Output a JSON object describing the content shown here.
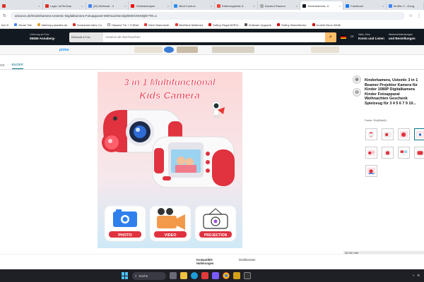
{
  "browser": {
    "tabs": [
      {
        "label": "",
        "color": "#d93025"
      },
      {
        "label": "Login: raTfe14an",
        "color": "#d93025"
      },
      {
        "label": "(20) Webmail - 4",
        "color": "#4285f4"
      },
      {
        "label": "Ghettoklampne",
        "color": "#ff0000"
      },
      {
        "label": "Mind Control -",
        "color": "#2b8ef0"
      },
      {
        "label": "Erfahrungsfeld: A",
        "color": "#f54336"
      },
      {
        "label": "Kamera Raumur",
        "color": "#aaaaaa"
      },
      {
        "label": "Kinderkamera, U",
        "color": "#131921",
        "active": true
      },
      {
        "label": "Facebook",
        "color": "#1877f2"
      },
      {
        "label": "fertiflor 2 - Goog",
        "color": "#4285f4"
      }
    ],
    "url": "amazon.de/Kinderkamera-Usteetic-Digitalkamera-Fotoapparat-Weihnachten/dp/B0DXXKMQB7?th=1",
    "bookmarks": [
      {
        "label": "hen K",
        "color": "#888"
      },
      {
        "label": "Neuer Tab",
        "color": "#4285f4"
      },
      {
        "label": "tabletop-paradies.de",
        "color": "#e0a030"
      },
      {
        "label": "Download video Co",
        "color": "#d93025"
      },
      {
        "label": "Hawese Tür + FuRart",
        "color": "#ffffff"
      },
      {
        "label": "Mein Warenkorb",
        "color": "#e53935"
      },
      {
        "label": "BestNetz Multimed",
        "color": "#e53935"
      },
      {
        "label": "SoBuy Regal BZR11",
        "color": "#c00"
      },
      {
        "label": "Software Upgrade",
        "color": "#555"
      },
      {
        "label": "SoBuy Waschbecke",
        "color": "#c00"
      },
      {
        "label": "Dunkle Neue Weltb",
        "color": "#c00"
      }
    ]
  },
  "amazon": {
    "deliver_line1": "Lieferung an Dino",
    "deliver_line2": "08456 Annaberg-",
    "search_category": "Elektronik & Foto",
    "search_placeholder": "Amazon.de durchsuchen",
    "account_line1": "Hallo, Dino",
    "account_line2": "Konto und Listen",
    "returns_line1": "Warenrücksendungen",
    "returns_line2": "und Bestellungen",
    "lang": "DE",
    "prime": "prime"
  },
  "subnav": {
    "tabs": [
      "OS",
      "BILDER"
    ],
    "active": 1
  },
  "product_image": {
    "headline1": "3 in 1 Multifunctional",
    "headline2": "Kids Camera",
    "labels": [
      "PHOTO",
      "VIDEO",
      "PROJECTION"
    ]
  },
  "product": {
    "title": "Kinderkamera, Usteetic 3 in 1 Beamer Projektor Kamera für Kinder 1080P Digitalkamera Kinder Fotoapparat Weihnachten Geschenk Spielzeug für 3 4 5 6 7 9 10...",
    "color_label": "Farbe: Rot(Weiß)",
    "zoom_in_icon": "zoom-in-icon",
    "zoom_out_icon": "zoom-out-icon"
  },
  "bottom": {
    "col1": "Kompatible Halterungen",
    "col2": "Drahtlosnutz",
    "graybar": "Auf die Liste"
  },
  "taskbar": {
    "search_label": "Suche"
  }
}
